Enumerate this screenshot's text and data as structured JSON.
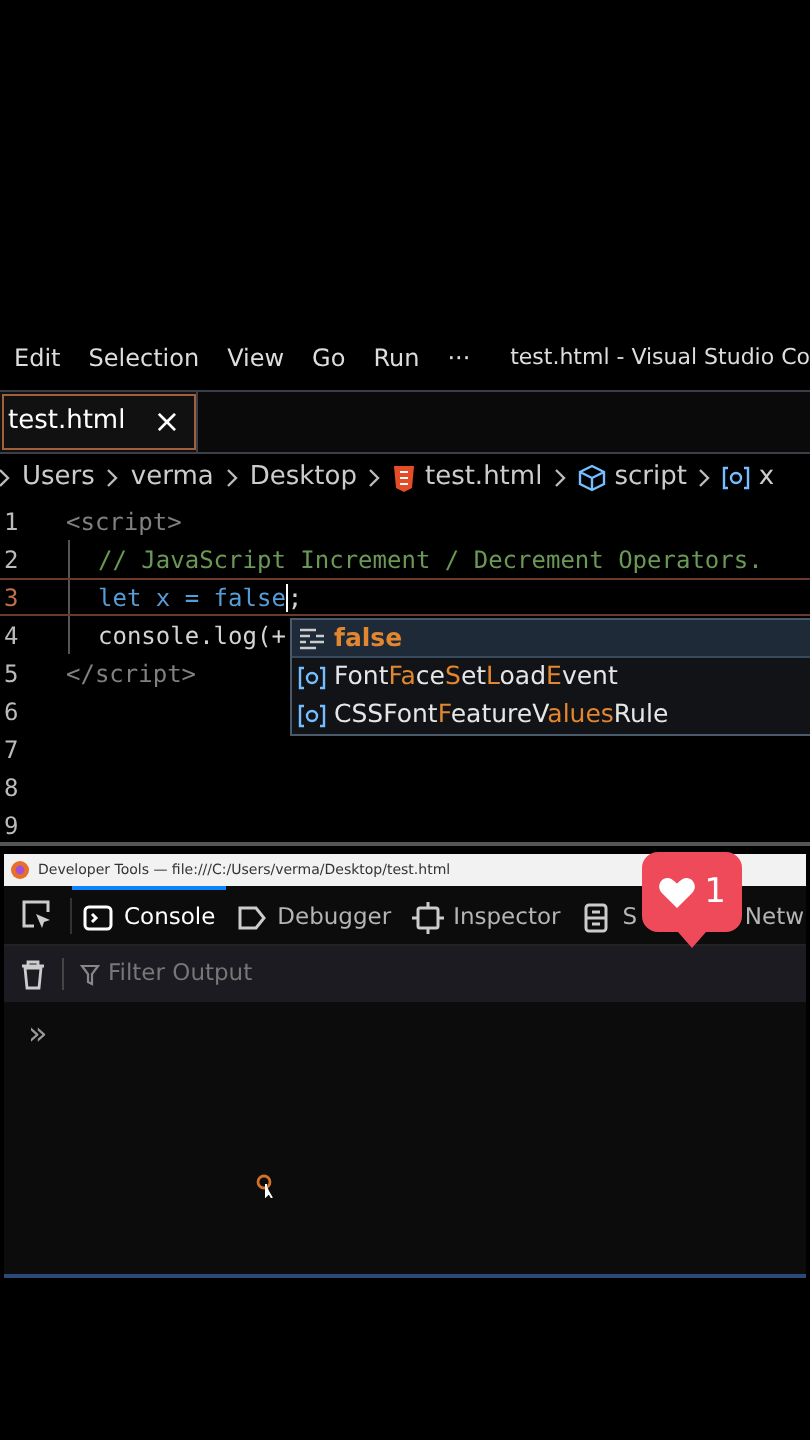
{
  "menu": [
    "Edit",
    "Selection",
    "View",
    "Go",
    "Run",
    "···"
  ],
  "window": {
    "title": "test.html - Visual Studio Co"
  },
  "tabs": [
    {
      "label": "test.html",
      "selected": true,
      "close": "×"
    }
  ],
  "breadcrumb": [
    {
      "kind": "folder",
      "label": "Users"
    },
    {
      "kind": "folder",
      "label": "verma"
    },
    {
      "kind": "folder",
      "label": "Desktop"
    },
    {
      "kind": "html",
      "label": "test.html"
    },
    {
      "kind": "module",
      "label": "script"
    },
    {
      "kind": "variable",
      "label": "x"
    }
  ],
  "editor": {
    "lines": [
      {
        "number": "1",
        "current": false,
        "tokens": [
          {
            "kind": "tag",
            "text": "<script>"
          }
        ]
      },
      {
        "number": "2",
        "current": false,
        "tokens": [
          {
            "kind": "comment",
            "text": "// JavaScript Increment / Decrement Operators."
          }
        ]
      },
      {
        "number": "3",
        "current": true,
        "tokens": [
          {
            "kind": "keyword",
            "text": "let x = false"
          },
          {
            "kind": "plain",
            "text": ";"
          }
        ]
      },
      {
        "number": "4",
        "current": false,
        "tokens": [
          {
            "kind": "plain",
            "text": "console.log(+"
          }
        ]
      },
      {
        "number": "5",
        "current": false,
        "tokens": [
          {
            "kind": "tag",
            "text": "</script>"
          }
        ]
      },
      {
        "number": "6",
        "current": false
      },
      {
        "number": "7",
        "current": false
      },
      {
        "number": "8",
        "current": false
      },
      {
        "number": "9",
        "current": false
      }
    ]
  },
  "suggestions": [
    {
      "kind": "keyword",
      "selected": true,
      "segments": [
        {
          "text": "false",
          "match": true
        }
      ]
    },
    {
      "kind": "variable",
      "selected": false,
      "segments": [
        {
          "text": "Font",
          "match": false
        },
        {
          "text": "Fa",
          "match": true
        },
        {
          "text": "ce",
          "match": false
        },
        {
          "text": "S",
          "match": true
        },
        {
          "text": "et",
          "match": false
        },
        {
          "text": "L",
          "match": true
        },
        {
          "text": "oad",
          "match": false
        },
        {
          "text": "E",
          "match": true
        },
        {
          "text": "vent",
          "match": false
        }
      ]
    },
    {
      "kind": "variable",
      "selected": false,
      "segments": [
        {
          "text": "CSSFont",
          "match": false
        },
        {
          "text": "F",
          "match": true
        },
        {
          "text": "eatureV",
          "match": false
        },
        {
          "text": "alu",
          "match": true
        },
        {
          "text": "es",
          "match": true
        },
        {
          "text": "Rule",
          "match": false
        }
      ]
    }
  ],
  "devtools": {
    "title": "Developer Tools — file:///C:/Users/verma/Desktop/test.html",
    "tabs": [
      {
        "kind": "console",
        "label": "Console",
        "selected": true
      },
      {
        "kind": "debugger",
        "label": "Debugger",
        "selected": false
      },
      {
        "kind": "inspector",
        "label": "Inspector",
        "selected": false
      },
      {
        "kind": "storage",
        "label": "S",
        "selected": false
      },
      {
        "kind": "network",
        "label": "Netw",
        "selected": false
      }
    ],
    "filter": {
      "placeholder": "Filter Output"
    },
    "prompt": "»"
  },
  "like_badge": {
    "count": "1"
  }
}
